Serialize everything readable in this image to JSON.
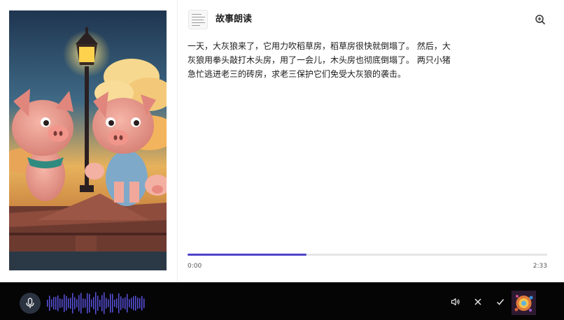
{
  "header": {
    "title": "故事朗读"
  },
  "story": {
    "text": "一天，大灰狼来了，它用力吹稻草房，稻草房很快就倒塌了。 然后，大灰狼用拳头敲打木头房，用了一会儿，木头房也彻底倒塌了。 两只小猪急忙逃进老三的砖房，求老三保护它们免受大灰狼的袭击。"
  },
  "player": {
    "current_time": "0:00",
    "total_time": "2:33",
    "progress": 0.33,
    "accent_color": "#4f43c9"
  },
  "voice_bar": {
    "background": "#050505",
    "waveform_color": "#5a52e0",
    "icons": {
      "mic": "microphone-icon",
      "volume": "volume-icon",
      "close": "close-icon",
      "confirm": "check-icon",
      "zoom": "zoom-in-icon"
    }
  }
}
